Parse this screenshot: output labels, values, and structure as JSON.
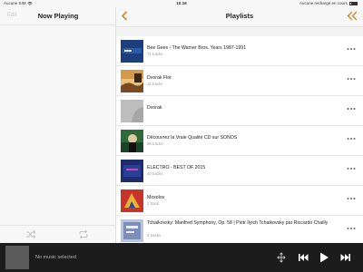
{
  "status_bar": {
    "carrier": "Aucune SIM",
    "wifi_icon": "wifi-icon",
    "time": "10:16",
    "charge_text": "Aucune recharge en cours",
    "battery_icon": "battery-icon"
  },
  "now_playing": {
    "edit_label": "Edit",
    "title": "Now Playing",
    "shuffle_icon": "shuffle-icon",
    "repeat_icon": "repeat-icon"
  },
  "playlists": {
    "title": "Playlists",
    "back_icon": "chevron-left-icon",
    "collapse_icon": "double-chevron-left-icon",
    "items": [
      {
        "title": "Bee Gees - The Warner Bros. Years 1987-1991",
        "subtitle": "71 tracks",
        "art": "#1d3e7c"
      },
      {
        "title": "Dvorak Flor",
        "subtitle": "12 tracks",
        "art": "#c0873b"
      },
      {
        "title": "Dvorak",
        "subtitle": "",
        "art": "#bdbdbd"
      },
      {
        "title": "Découvrez la Vraie Qualité CD sur SONOS",
        "subtitle": "35 tracks",
        "art": "#2e6b3a"
      },
      {
        "title": "ELECTRO - BEST OF 2015",
        "subtitle": "40 tracks",
        "art": "#1f2c6b"
      },
      {
        "title": "Mosolov",
        "subtitle": "1 track",
        "art": "#c8342a"
      },
      {
        "title": "Tchaikovsky: Manfred Symphony, Op. 58 | Piotr Ilyich Tchaikovsky par Riccardo Chailly",
        "subtitle": "4 tracks",
        "art": "#7d8fb8"
      }
    ]
  },
  "player": {
    "status": "No music selected",
    "volume_icon": "volume-icon",
    "previous_icon": "previous-icon",
    "play_icon": "play-icon",
    "next_icon": "next-icon"
  }
}
